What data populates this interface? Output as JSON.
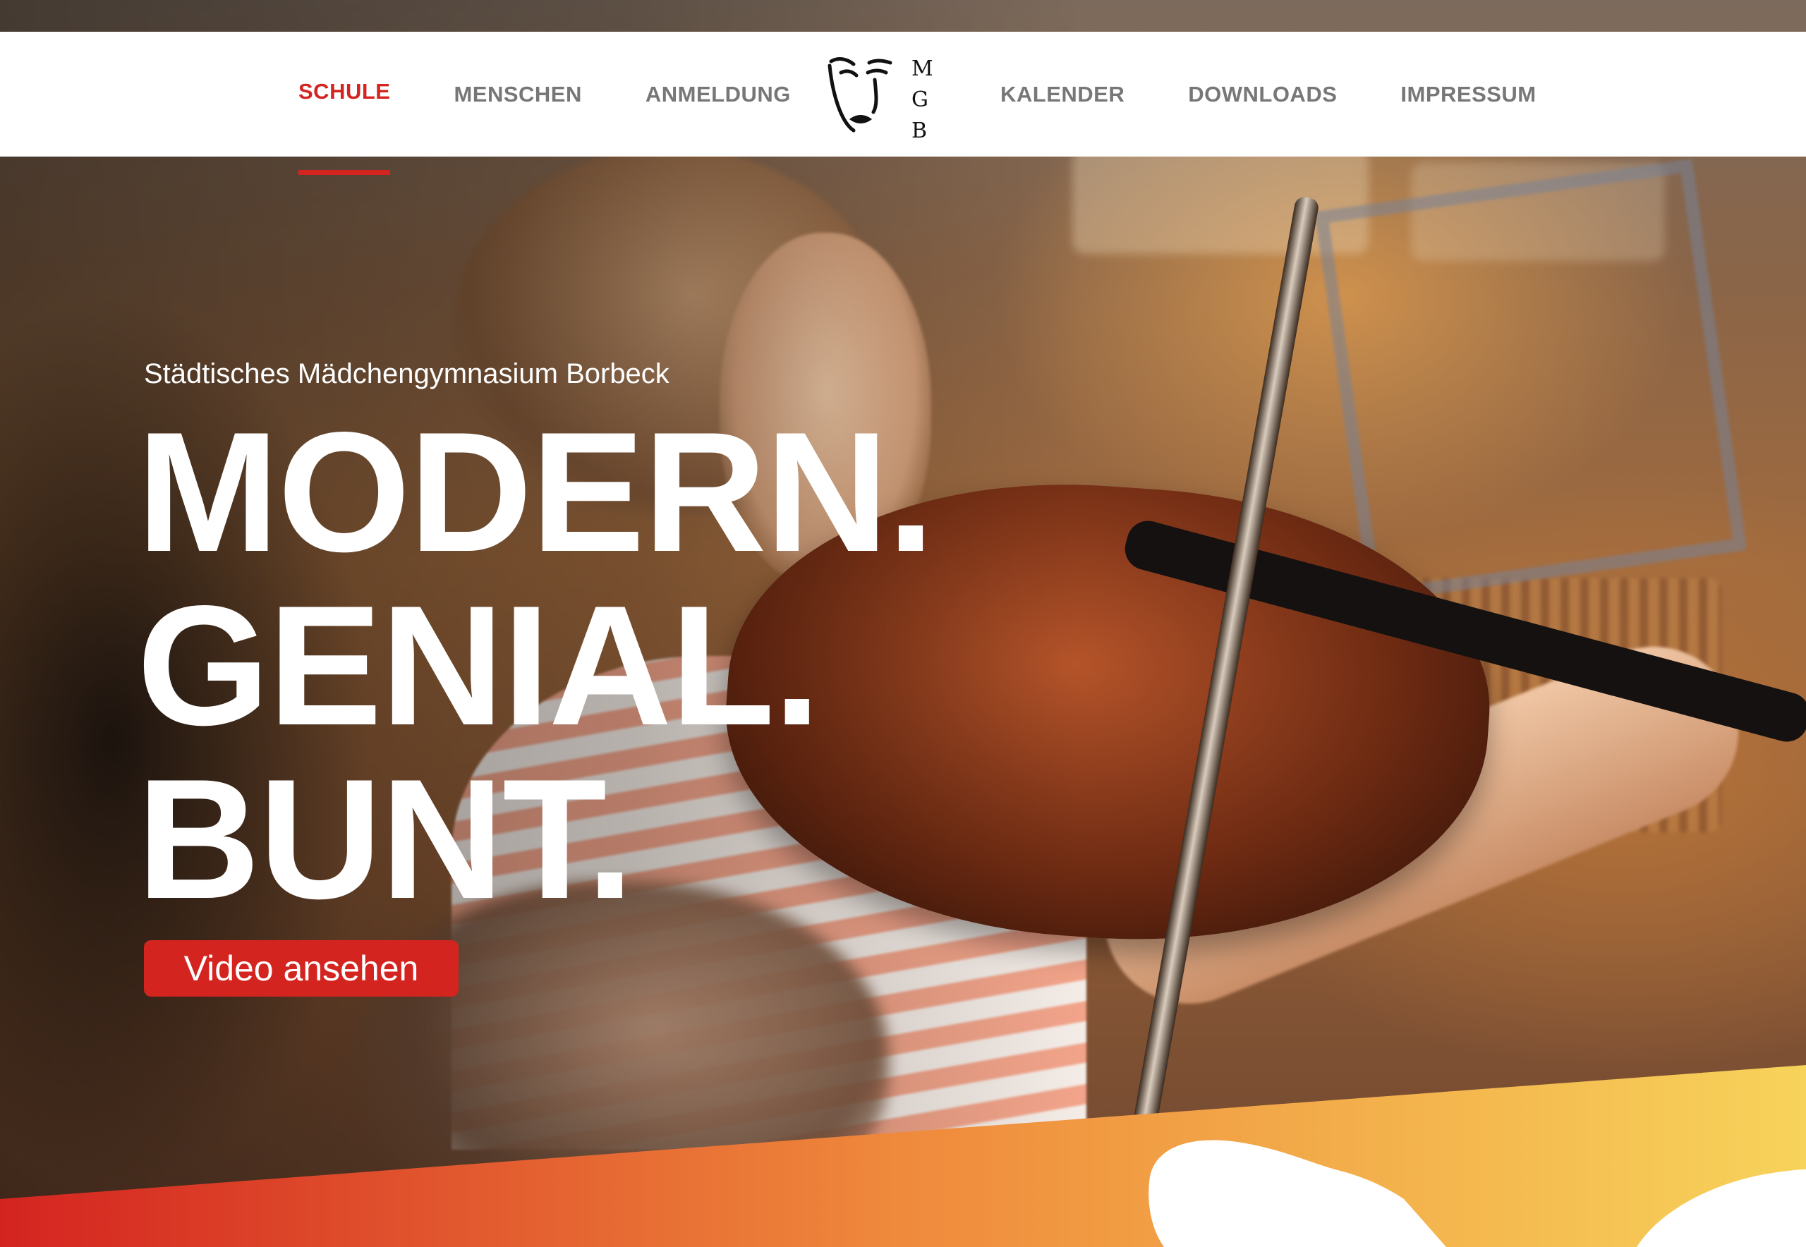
{
  "nav": {
    "left": [
      {
        "label": "SCHULE",
        "active": true
      },
      {
        "label": "MENSCHEN",
        "active": false
      },
      {
        "label": "ANMELDUNG",
        "active": false
      }
    ],
    "right": [
      {
        "label": "KALENDER",
        "active": false
      },
      {
        "label": "DOWNLOADS",
        "active": false
      },
      {
        "label": "IMPRESSUM",
        "active": false
      }
    ],
    "logo": {
      "icon": "face-logo-icon",
      "letters": [
        "M",
        "G",
        "B"
      ]
    }
  },
  "hero": {
    "subtitle": "Städtisches Mädchengymnasium Borbeck",
    "headline": [
      "MODERN.",
      "GENIAL.",
      "BUNT."
    ],
    "cta_label": "Video ansehen",
    "photo_description_icon": "violin-photo"
  },
  "colors": {
    "accent": "#d42420",
    "nav_text": "#777777",
    "header_bg": "#ffffff",
    "gradient_start": "#d42420",
    "gradient_mid": "#ef8a3c",
    "gradient_end": "#f7d35a"
  }
}
